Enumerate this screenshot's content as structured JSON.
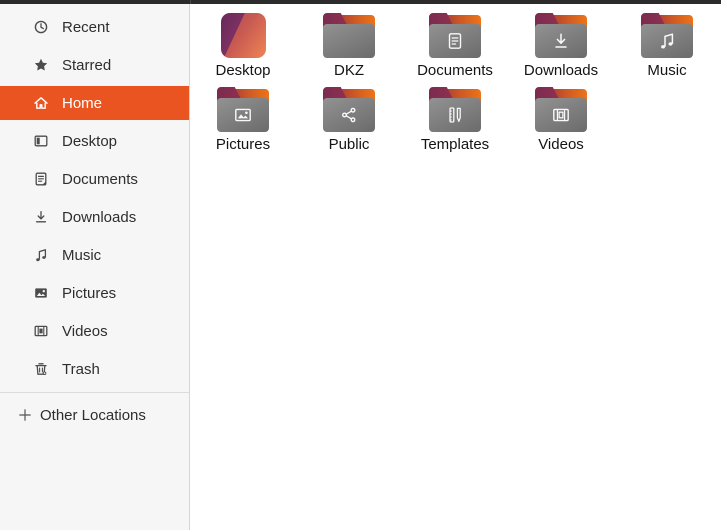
{
  "window": {
    "topbar": {
      "color": "#2b2b2b"
    }
  },
  "sidebar": {
    "items": [
      {
        "label": "Recent",
        "icon": "recent-icon",
        "active": false
      },
      {
        "label": "Starred",
        "icon": "star-icon",
        "active": false
      },
      {
        "label": "Home",
        "icon": "home-icon",
        "active": true
      },
      {
        "label": "Desktop",
        "icon": "desktop-icon",
        "active": false
      },
      {
        "label": "Documents",
        "icon": "documents-icon",
        "active": false
      },
      {
        "label": "Downloads",
        "icon": "downloads-icon",
        "active": false
      },
      {
        "label": "Music",
        "icon": "music-icon",
        "active": false
      },
      {
        "label": "Pictures",
        "icon": "pictures-icon",
        "active": false
      },
      {
        "label": "Videos",
        "icon": "videos-icon",
        "active": false
      },
      {
        "label": "Trash",
        "icon": "trash-icon",
        "active": false
      }
    ],
    "other_locations": {
      "label": "Other Locations",
      "icon": "plus-icon"
    },
    "colors": {
      "background": "#f6f6f6",
      "active_background": "#e95420",
      "active_text": "#ffffff",
      "text": "#2e2e2e",
      "border": "#d5d5d3"
    }
  },
  "content": {
    "background": "#ffffff",
    "label_color": "#141414",
    "folders": [
      {
        "name": "Desktop",
        "icon": "desktop-gradient-icon",
        "glyph": null
      },
      {
        "name": "DKZ",
        "icon": "folder-icon",
        "glyph": null
      },
      {
        "name": "Documents",
        "icon": "folder-icon",
        "glyph": "document-glyph-icon"
      },
      {
        "name": "Downloads",
        "icon": "folder-icon",
        "glyph": "download-glyph-icon"
      },
      {
        "name": "Music",
        "icon": "folder-icon",
        "glyph": "music-note-glyph-icon"
      },
      {
        "name": "Pictures",
        "icon": "folder-icon",
        "glyph": "image-glyph-icon"
      },
      {
        "name": "Public",
        "icon": "folder-icon",
        "glyph": "share-glyph-icon"
      },
      {
        "name": "Templates",
        "icon": "folder-icon",
        "glyph": "template-glyph-icon"
      },
      {
        "name": "Videos",
        "icon": "folder-icon",
        "glyph": "film-glyph-icon"
      }
    ],
    "folder_colors": {
      "front_top": "#929292",
      "front_bottom": "#6b6b6b",
      "back_left": "#9e3440",
      "back_right": "#ed7418",
      "tab_left": "#7b2b50",
      "tab_right": "#8f3050",
      "desktop_purple_dark": "#67285b",
      "desktop_purple": "#7d3162",
      "desktop_orange": "#ef8455"
    }
  }
}
